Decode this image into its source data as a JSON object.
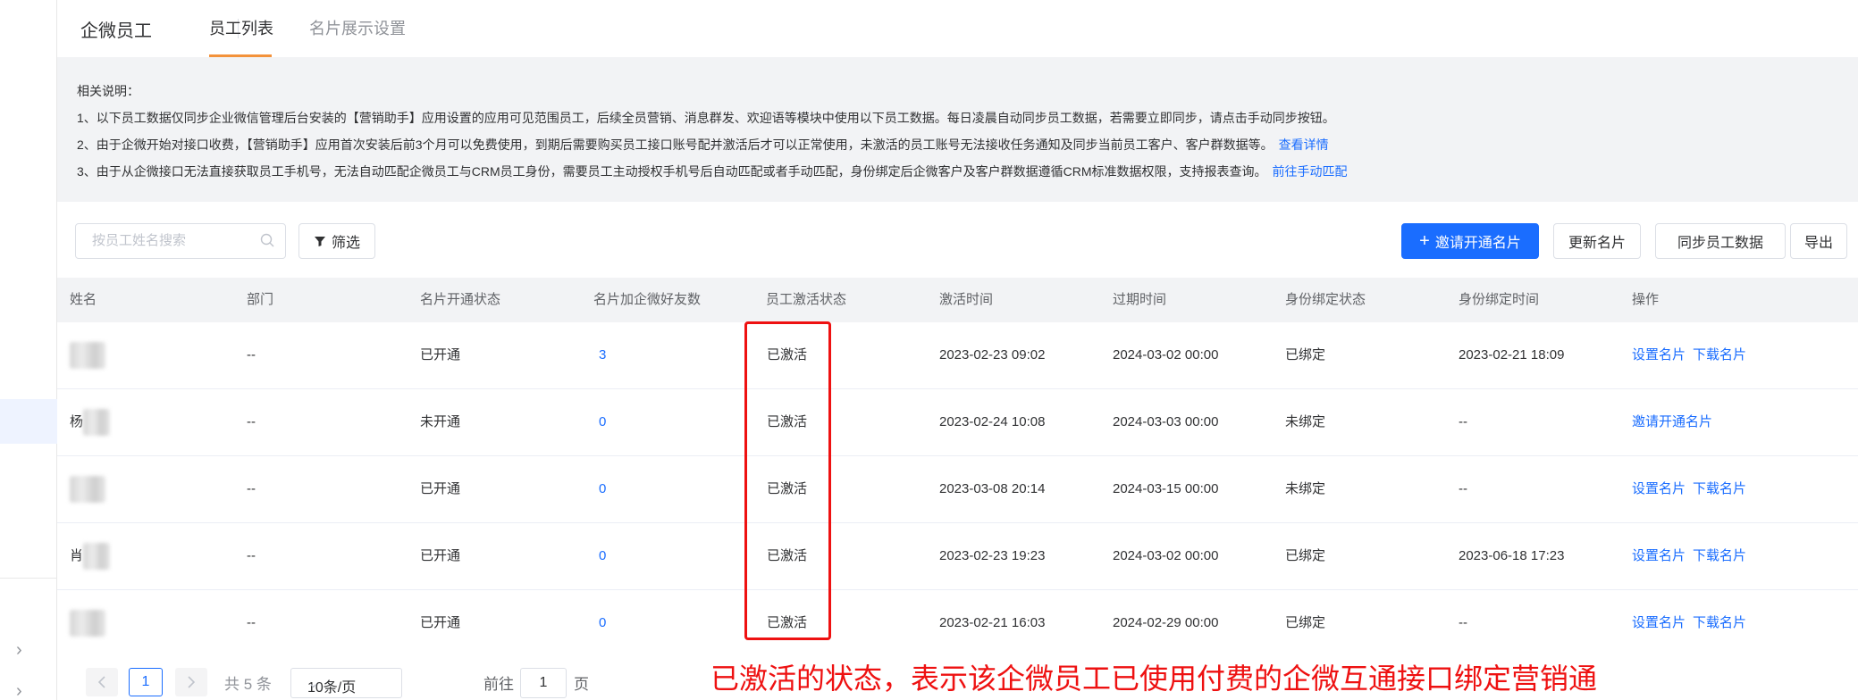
{
  "header": {
    "brand": "企微员工",
    "tabs": [
      {
        "label": "员工列表",
        "active": true
      },
      {
        "label": "名片展示设置",
        "active": false
      }
    ]
  },
  "notice": {
    "title": "相关说明：",
    "lines": [
      {
        "text": "1、以下员工数据仅同步企业微信管理后台安装的【营销助手】应用设置的应用可见范围员工，后续全员营销、消息群发、欢迎语等模块中使用以下员工数据。每日凌晨自动同步员工数据，若需要立即同步，请点击手动同步按钮。",
        "link": ""
      },
      {
        "text": "2、由于企微开始对接口收费，【营销助手】应用首次安装后前3个月可以免费使用，到期后需要购买员工接口账号配并激活后才可以正常使用，未激活的员工账号无法接收任务通知及同步当前员工客户、客户群数据等。",
        "link": "查看详情"
      },
      {
        "text": "3、由于从企微接口无法直接获取员工手机号，无法自动匹配企微员工与CRM员工身份，需要员工主动授权手机号后自动匹配或者手动匹配，身份绑定后企微客户及客户群数据遵循CRM标准数据权限，支持报表查询。",
        "link": "前往手动匹配"
      }
    ]
  },
  "toolbar": {
    "search_placeholder": "按员工姓名搜索",
    "filter_label": "筛选",
    "invite_label": "邀请开通名片",
    "update_label": "更新名片",
    "sync_label": "同步员工数据",
    "export_label": "导出"
  },
  "table": {
    "columns": [
      "姓名",
      "部门",
      "名片开通状态",
      "名片加企微好友数",
      "员工激活状态",
      "激活时间",
      "过期时间",
      "身份绑定状态",
      "身份绑定时间",
      "操作"
    ],
    "rows": [
      {
        "name_initial": "",
        "dept": "--",
        "card_status": "已开通",
        "friends": "3",
        "activation": "已激活",
        "activated_at": "2023-02-23 09:02",
        "expires_at": "2024-03-02 00:00",
        "bind_status": "已绑定",
        "bind_time": "2023-02-21 18:09",
        "action1": "设置名片",
        "action2": "下载名片"
      },
      {
        "name_initial": "杨",
        "dept": "--",
        "card_status": "未开通",
        "friends": "0",
        "activation": "已激活",
        "activated_at": "2023-02-24 10:08",
        "expires_at": "2024-03-03 00:00",
        "bind_status": "未绑定",
        "bind_time": "--",
        "action1": "邀请开通名片",
        "action2": ""
      },
      {
        "name_initial": "",
        "dept": "--",
        "card_status": "已开通",
        "friends": "0",
        "activation": "已激活",
        "activated_at": "2023-03-08 20:14",
        "expires_at": "2024-03-15 00:00",
        "bind_status": "未绑定",
        "bind_time": "--",
        "action1": "设置名片",
        "action2": "下载名片"
      },
      {
        "name_initial": "肖",
        "dept": "--",
        "card_status": "已开通",
        "friends": "0",
        "activation": "已激活",
        "activated_at": "2023-02-23 19:23",
        "expires_at": "2024-03-02 00:00",
        "bind_status": "已绑定",
        "bind_time": "2023-06-18 17:23",
        "action1": "设置名片",
        "action2": "下载名片"
      },
      {
        "name_initial": "",
        "dept": "--",
        "card_status": "已开通",
        "friends": "0",
        "activation": "已激活",
        "activated_at": "2023-02-21 16:03",
        "expires_at": "2024-02-29 00:00",
        "bind_status": "已绑定",
        "bind_time": "--",
        "action1": "设置名片",
        "action2": "下载名片"
      }
    ]
  },
  "pagination": {
    "current_page": "1",
    "total_text": "共 5 条",
    "page_size": "10条/页",
    "goto_prefix": "前往",
    "goto_value": "1",
    "goto_suffix": "页"
  },
  "annotation": "已激活的状态，表示该企微员工已使用付费的企微互通接口绑定营销通",
  "colors": {
    "accent": "#1a6dff",
    "tab_underline": "#f3923b",
    "highlight": "#ee1111"
  }
}
